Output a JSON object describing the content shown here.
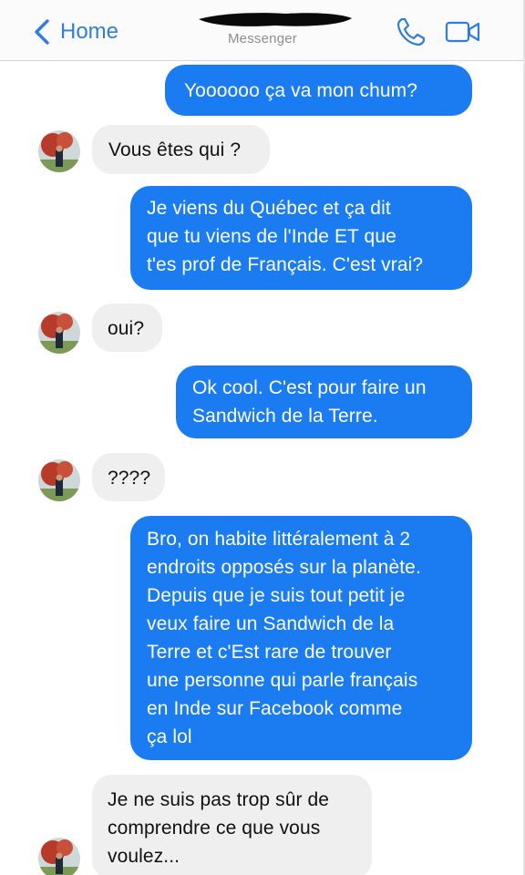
{
  "header": {
    "back_label": "Home",
    "subtitle": "Messenger",
    "accent_color": "#2f7de1",
    "icons": {
      "back": "chevron-left-icon",
      "call": "phone-icon",
      "video": "video-camera-icon"
    }
  },
  "theme": {
    "sent_bubble_color": "#1b7cf2",
    "received_bubble_color": "#efeff0"
  },
  "messages": [
    {
      "direction": "sent",
      "text": "Yoooooo ça va mon chum?"
    },
    {
      "direction": "received",
      "text": "Vous êtes qui ?"
    },
    {
      "direction": "sent",
      "text": "Je viens du Québec et ça dit\nque tu viens de l'Inde ET que\nt'es prof de Français. C'est vrai?"
    },
    {
      "direction": "received",
      "text": "oui?"
    },
    {
      "direction": "sent",
      "text": "Ok cool. C'est pour faire un\nSandwich de la Terre."
    },
    {
      "direction": "received",
      "text": "????"
    },
    {
      "direction": "sent",
      "text": "Bro, on habite littéralement à 2\nendroits opposés sur la planète.\nDepuis que je suis tout petit je\nveux faire un Sandwich de la\nTerre et c'Est rare de trouver\nune personne qui parle français\nen Inde sur Facebook comme\nça lol"
    },
    {
      "direction": "received",
      "text": "Je ne suis pas trop sûr de\ncomprendre ce que vous\nvoulez..."
    }
  ]
}
